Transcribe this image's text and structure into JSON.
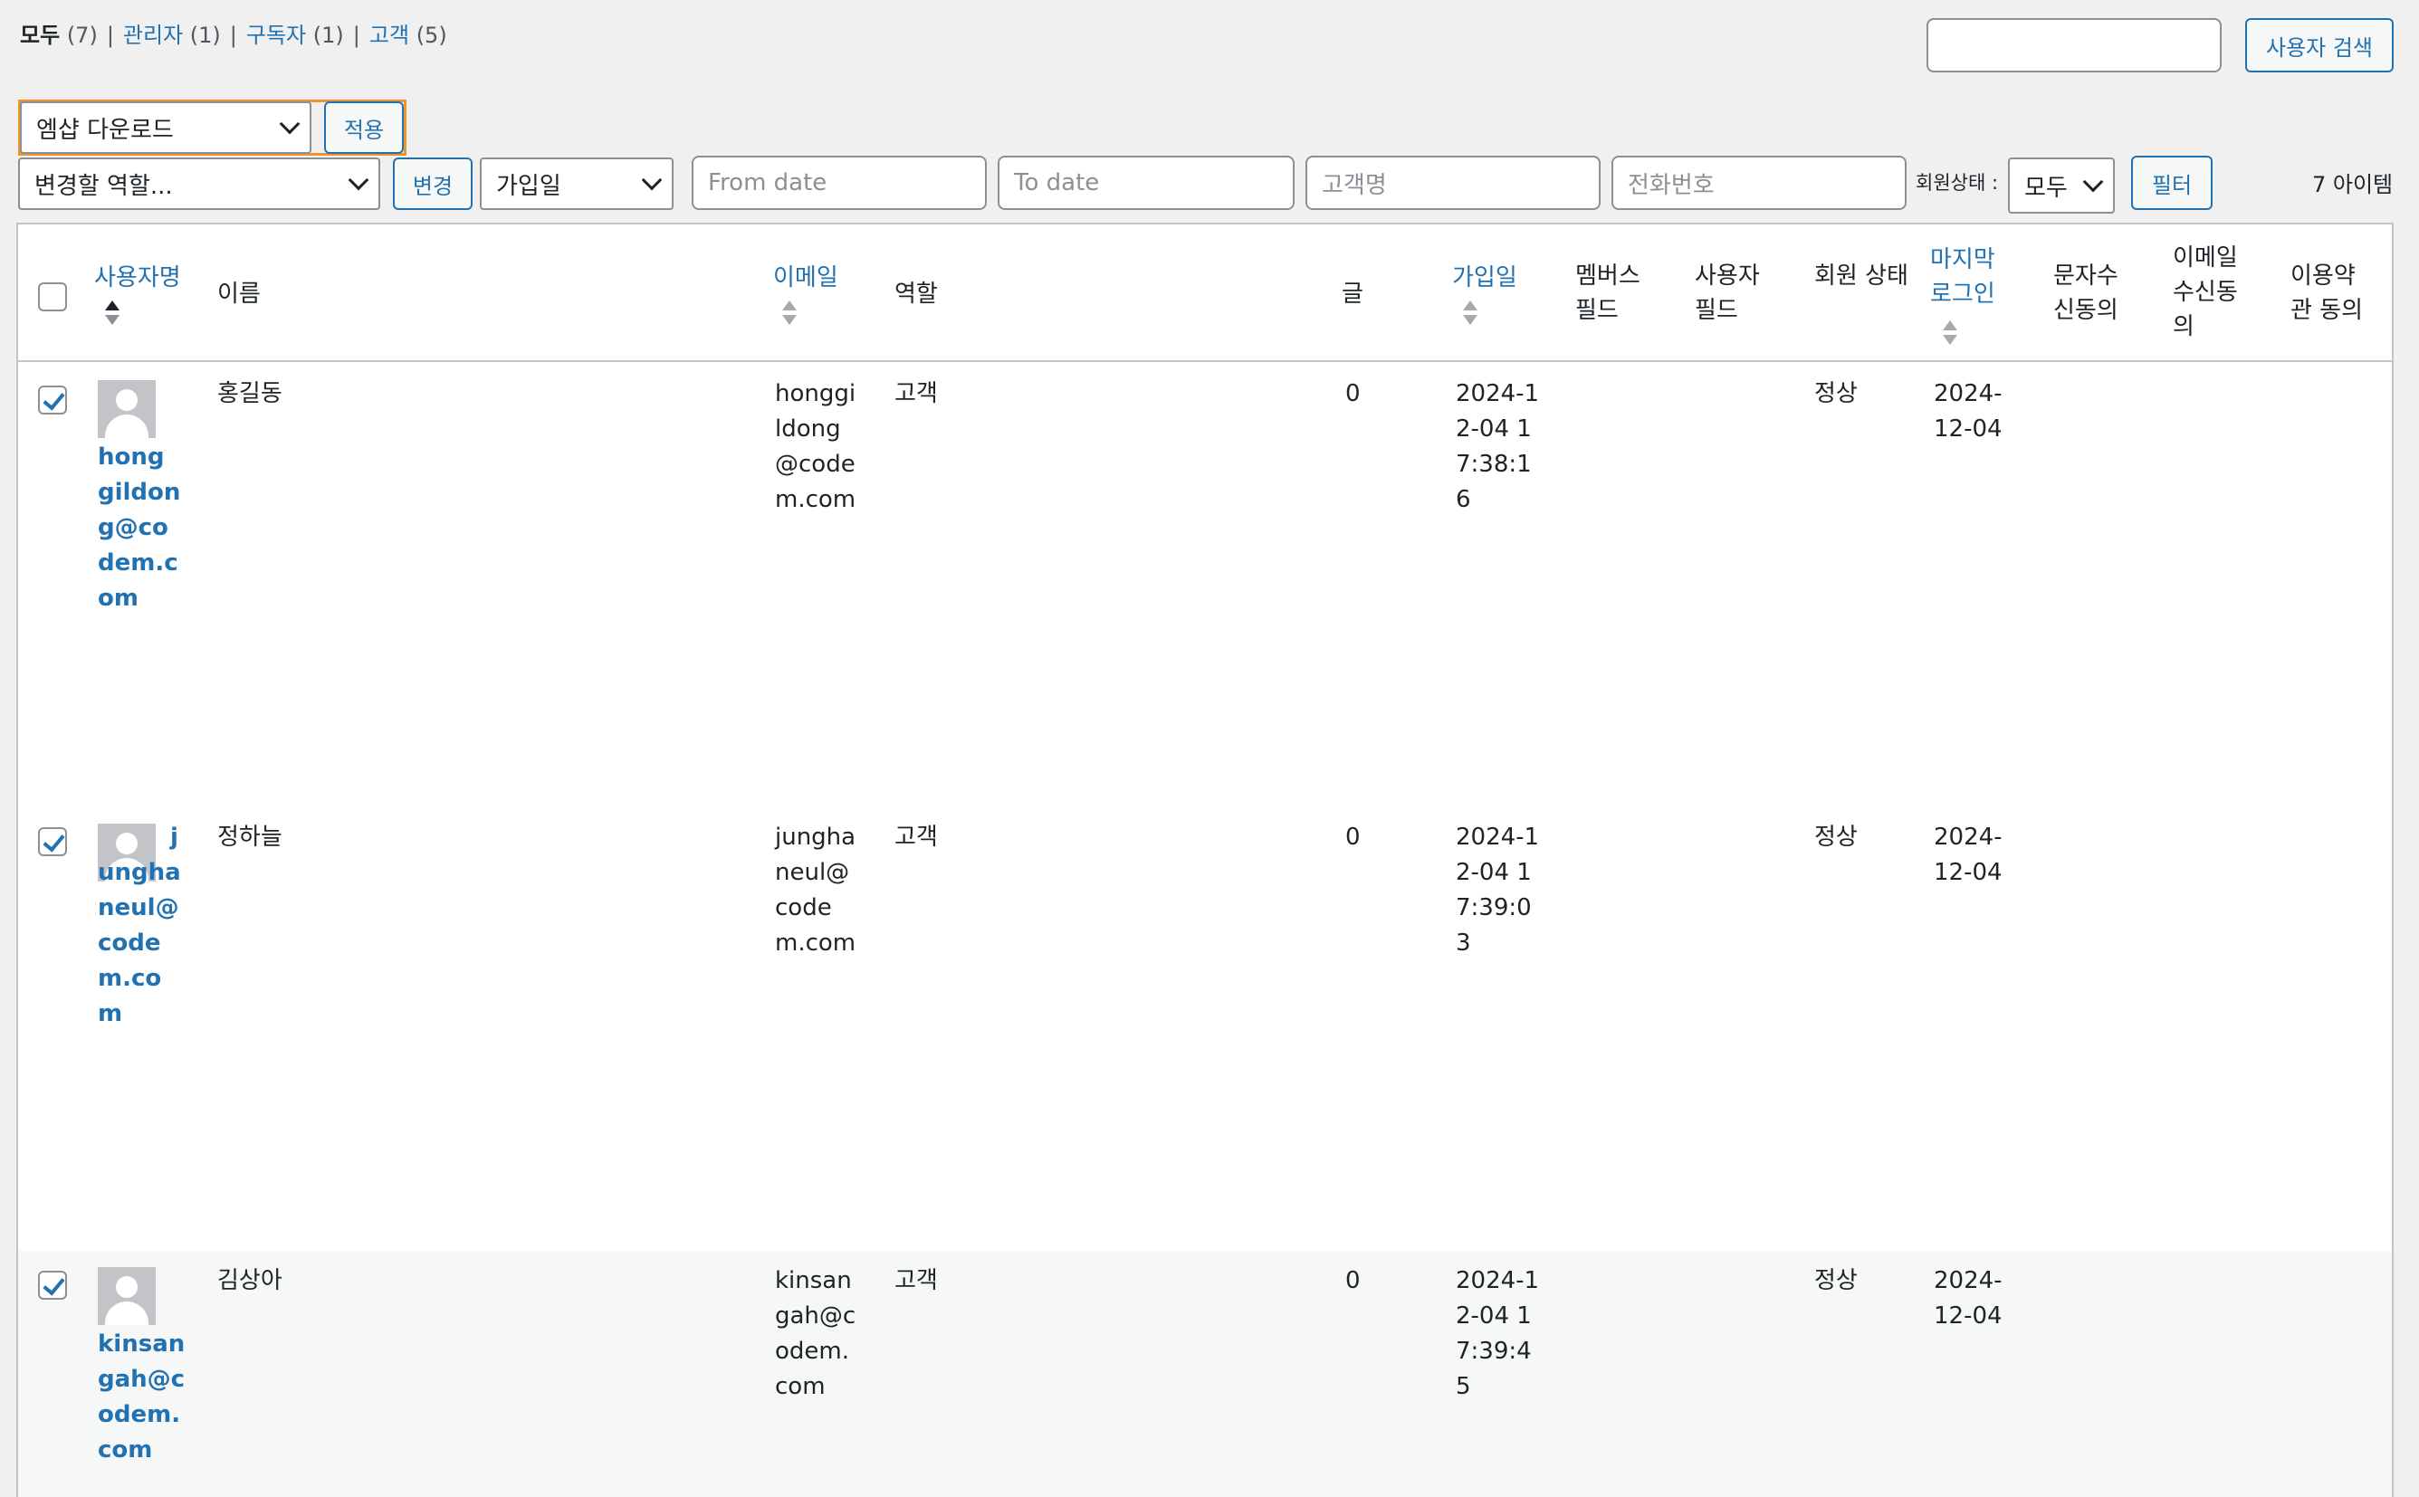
{
  "views": [
    {
      "label": "모두",
      "count": "(7)",
      "current": true
    },
    {
      "label": "관리자",
      "count": "(1)",
      "current": false
    },
    {
      "label": "구독자",
      "count": "(1)",
      "current": false
    },
    {
      "label": "고객",
      "count": "(5)",
      "current": false
    }
  ],
  "search": {
    "value": "",
    "button_label": "사용자 검색"
  },
  "bulk": {
    "selected": "엠샵 다운로드",
    "apply_label": "적용"
  },
  "filters": {
    "role_selected": "변경할 역할...",
    "change_label": "변경",
    "date_type_selected": "가입일",
    "from_date_placeholder": "From date",
    "to_date_placeholder": "To date",
    "customer_name_placeholder": "고객명",
    "phone_placeholder": "전화번호",
    "status_label": "회원상태 :",
    "status_selected": "모두",
    "filter_label": "필터"
  },
  "items_count": "7 아이템",
  "columns": {
    "username": "사용자명",
    "name": "이름",
    "email": "이메일",
    "role": "역할",
    "posts": "글",
    "registered": "가입일",
    "membership": "멤버스 필드",
    "user_field": "사용자 필드",
    "member_status": "회원 상태",
    "last_login": "마지막 로그인",
    "sms_consent": "문자수신동의",
    "email_consent": "이메일수신동의",
    "terms_consent": "이용약관 동의"
  },
  "rows": [
    {
      "username": "honggildong@codem.com",
      "name": "홍길동",
      "email": "honggildong@codem.com",
      "role": "고객",
      "posts": "0",
      "registered": "2024-12-04 17:38:16",
      "member_status": "정상",
      "last_login": "2024-12-04",
      "checked": true
    },
    {
      "username": "jungha neul@codem.com",
      "name": "정하늘",
      "email": "junghaneul@codem.com",
      "role": "고객",
      "posts": "0",
      "registered": "2024-12-04 17:39:03",
      "member_status": "정상",
      "last_login": "2024-12-04",
      "checked": true
    },
    {
      "username": "kinsangah@codem.com",
      "name": "김상아",
      "email": "kinsangah@codem.com",
      "role": "고객",
      "posts": "0",
      "registered": "2024-12-04 17:39:45",
      "member_status": "정상",
      "last_login": "2024-12-04",
      "checked": true
    }
  ]
}
